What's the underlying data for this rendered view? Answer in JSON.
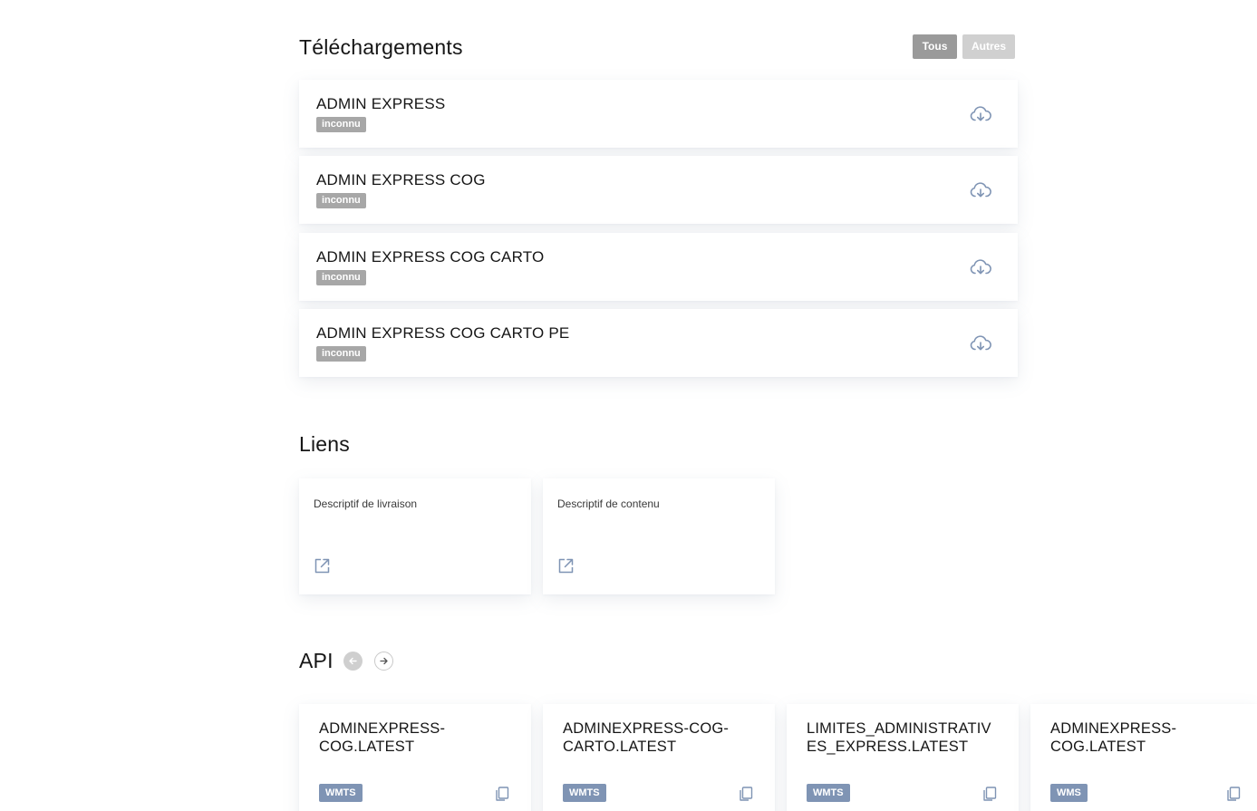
{
  "downloads": {
    "title": "Téléchargements",
    "filters": {
      "all": "Tous",
      "others": "Autres"
    },
    "items": [
      {
        "name": "ADMIN EXPRESS",
        "badge": "inconnu"
      },
      {
        "name": "ADMIN EXPRESS COG",
        "badge": "inconnu"
      },
      {
        "name": "ADMIN EXPRESS COG CARTO",
        "badge": "inconnu"
      },
      {
        "name": "ADMIN EXPRESS COG CARTO PE",
        "badge": "inconnu"
      }
    ],
    "icon": "cloud-download-icon"
  },
  "links": {
    "title": "Liens",
    "items": [
      {
        "label": "Descriptif de livraison",
        "icon": "external-link-icon"
      },
      {
        "label": "Descriptif de contenu",
        "icon": "external-link-icon"
      }
    ]
  },
  "api": {
    "title": "API",
    "nav": {
      "prev": "arrow-left-icon",
      "next": "arrow-right-icon"
    },
    "items": [
      {
        "name": "ADMINEXPRESS-COG.LATEST",
        "name_lines": [
          "ADMINEXPRESS-",
          "COG.LATEST"
        ],
        "badge": "WMTS"
      },
      {
        "name": "ADMINEXPRESS-COG-CARTO.LATEST",
        "name_lines": [
          "ADMINEXPRESS-COG-",
          "CARTO.LATEST"
        ],
        "badge": "WMTS"
      },
      {
        "name": "LIMITES_ADMINISTRATIVES_EXPRESS.LATEST",
        "name_lines": [
          "LIMITES_ADMINISTRATIV",
          "ES_EXPRESS.LATEST"
        ],
        "badge": "WMTS"
      },
      {
        "name": "ADMINEXPRESS-COG.LATEST",
        "name_lines": [
          "ADMINEXPRESS-",
          "COG.LATEST"
        ],
        "badge": "WMS"
      }
    ],
    "icon": "copy-icon"
  },
  "colors": {
    "icon_blue": "#7f94b4",
    "badge_grey": "#a7a7a7",
    "filter_active": "#9a9a9a",
    "filter_inactive": "#d0d0d0"
  }
}
